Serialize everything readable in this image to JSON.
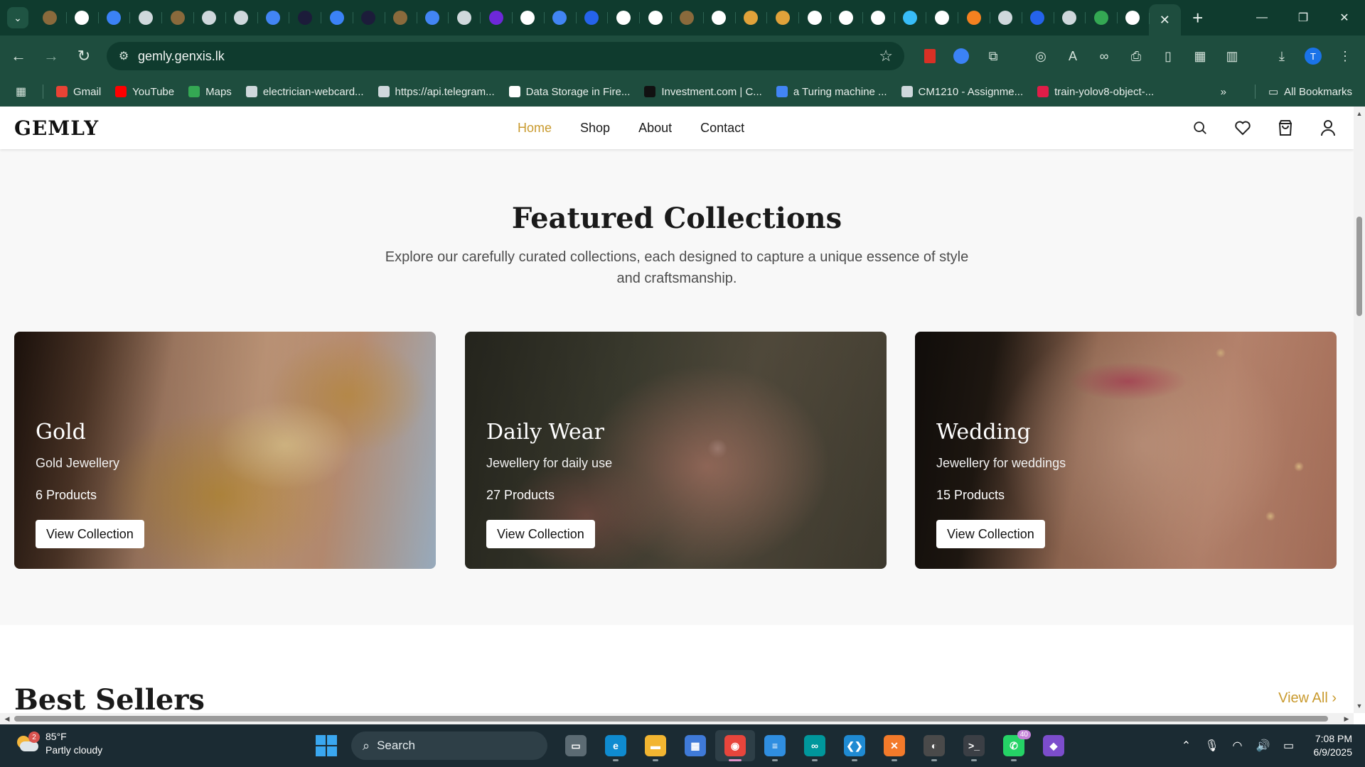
{
  "browser": {
    "url": "gemly.genxis.lk",
    "tabs": [
      {
        "icon": "dropdown-icon"
      },
      {
        "icon": "ant-icon",
        "color": "#8a6a3c"
      },
      {
        "icon": "openai-icon",
        "color": "#ffffff"
      },
      {
        "icon": "butterfly-icon",
        "color": "#3b82f6"
      },
      {
        "icon": "globe-icon",
        "color": "#cfd8dc"
      },
      {
        "icon": "ant-icon",
        "color": "#8a6a3c"
      },
      {
        "icon": "globe-icon",
        "color": "#cfd8dc"
      },
      {
        "icon": "globe-icon",
        "color": "#cfd8dc"
      },
      {
        "icon": "google-icon",
        "color": "#4285f4"
      },
      {
        "icon": "lambda-icon",
        "color": "#1c1c3a"
      },
      {
        "icon": "butterfly-icon",
        "color": "#3b82f6"
      },
      {
        "icon": "lambda-icon",
        "color": "#1c1c3a"
      },
      {
        "icon": "ant-icon",
        "color": "#8a6a3c"
      },
      {
        "icon": "google-icon",
        "color": "#4285f4"
      },
      {
        "icon": "globe-icon",
        "color": "#cfd8dc"
      },
      {
        "icon": "bolt-icon",
        "color": "#6d28d9"
      },
      {
        "icon": "openai-icon",
        "color": "#ffffff"
      },
      {
        "icon": "docs-icon",
        "color": "#4285f4"
      },
      {
        "icon": "c-icon",
        "color": "#2563eb"
      },
      {
        "icon": "github-icon",
        "color": "#ffffff"
      },
      {
        "icon": "github-icon",
        "color": "#ffffff"
      },
      {
        "icon": "ant-icon",
        "color": "#8a6a3c"
      },
      {
        "icon": "openai-icon",
        "color": "#ffffff"
      },
      {
        "icon": "mountain-icon",
        "color": "#e0a23a"
      },
      {
        "icon": "mountain-icon",
        "color": "#e0a23a"
      },
      {
        "icon": "openai-icon",
        "color": "#ffffff"
      },
      {
        "icon": "github-icon",
        "color": "#ffffff"
      },
      {
        "icon": "github-icon",
        "color": "#ffffff"
      },
      {
        "icon": "cloud-icon",
        "color": "#38bdf8"
      },
      {
        "icon": "openai-icon",
        "color": "#ffffff"
      },
      {
        "icon": "cloudflare-icon",
        "color": "#f48120"
      },
      {
        "icon": "globe-icon",
        "color": "#cfd8dc"
      },
      {
        "icon": "p-icon",
        "color": "#2563eb"
      },
      {
        "icon": "globe-icon",
        "color": "#cfd8dc"
      },
      {
        "icon": "drive-icon",
        "color": "#34a853"
      },
      {
        "icon": "openai-icon",
        "color": "#ffffff"
      }
    ],
    "bookmarks": [
      {
        "label": "Gmail",
        "color": "#ea4335"
      },
      {
        "label": "YouTube",
        "color": "#ff0000"
      },
      {
        "label": "Maps",
        "color": "#34a853"
      },
      {
        "label": "electrician-webcard...",
        "color": "#cfd8dc"
      },
      {
        "label": "https://api.telegram...",
        "color": "#cfd8dc"
      },
      {
        "label": "Data Storage in Fire...",
        "color": "#ffffff"
      },
      {
        "label": "Investment.com | C...",
        "color": "#111111"
      },
      {
        "label": "a Turing machine ...",
        "color": "#4285f4"
      },
      {
        "label": "CM1210 - Assignme...",
        "color": "#cfd8dc"
      },
      {
        "label": "train-yolov8-object-...",
        "color": "#e11d48"
      }
    ],
    "all_bookmarks": "All Bookmarks",
    "profile_initial": "T"
  },
  "site": {
    "logo": "GEMLY",
    "nav": [
      "Home",
      "Shop",
      "About",
      "Contact"
    ],
    "active_nav": "Home",
    "accent_color": "#c99a2e"
  },
  "featured": {
    "title": "Featured Collections",
    "subtitle": "Explore our carefully curated collections, each designed to capture a unique essence of style and craftsmanship.",
    "collections": [
      {
        "title": "Gold",
        "description": "Gold Jewellery",
        "count": "6 Products",
        "button": "View Collection"
      },
      {
        "title": "Daily Wear",
        "description": "Jewellery for daily use",
        "count": "27 Products",
        "button": "View Collection"
      },
      {
        "title": "Wedding",
        "description": "Jewellery for weddings",
        "count": "15 Products",
        "button": "View Collection"
      }
    ]
  },
  "best_sellers": {
    "title": "Best Sellers",
    "view_all": "View All"
  },
  "taskbar": {
    "weather_temp": "85°F",
    "weather_desc": "Partly cloudy",
    "weather_badge": "2",
    "search_placeholder": "Search",
    "apps": [
      {
        "name": "task-view",
        "color": "#5c6b73",
        "glyph": "▭"
      },
      {
        "name": "edge",
        "color": "#0f8bd0",
        "glyph": "e"
      },
      {
        "name": "file-explorer",
        "color": "#f2b531",
        "glyph": "▬"
      },
      {
        "name": "microsoft-store",
        "color": "#3f7ad8",
        "glyph": "▦"
      },
      {
        "name": "chrome",
        "color": "#e8453c",
        "glyph": "◉"
      },
      {
        "name": "notepad",
        "color": "#2f8ee0",
        "glyph": "≡"
      },
      {
        "name": "arduino",
        "color": "#00979c",
        "glyph": "∞"
      },
      {
        "name": "vscode",
        "color": "#1f8ad2",
        "glyph": "❮❯"
      },
      {
        "name": "xampp",
        "color": "#f37a2a",
        "glyph": "✕"
      },
      {
        "name": "obs",
        "color": "#4a4a4a",
        "glyph": "◐"
      },
      {
        "name": "terminal",
        "color": "#3b3f45",
        "glyph": ">_"
      },
      {
        "name": "whatsapp",
        "color": "#25d366",
        "glyph": "✆"
      },
      {
        "name": "obsidian",
        "color": "#7c4dcc",
        "glyph": "◆"
      }
    ],
    "whatsapp_badge": "40",
    "time": "7:08 PM",
    "date": "6/9/2025"
  }
}
